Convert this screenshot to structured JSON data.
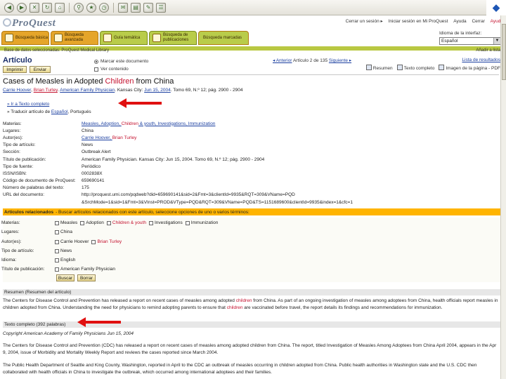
{
  "browser": {
    "logo_text": "◆"
  },
  "header": {
    "logo": "ProQuest",
    "top_links": [
      "Cerrar un sesión ▸",
      "Iniciar sesión en Mi ProQuest",
      "Ayuda",
      "Cerrar",
      "Ayuda"
    ],
    "language_label": "Idioma de la interfaz:",
    "language_value": "Español"
  },
  "tabs": [
    {
      "label": "Búsqueda básica"
    },
    {
      "label": "Búsqueda avanzada"
    },
    {
      "label": "Guía temática"
    },
    {
      "label": "Búsqueda de publicaciones"
    }
  ],
  "tab_plain": "Búsqueda marcadas",
  "breadcrumb": "Base de datos seleccionadas: ProQuest Medical Library",
  "breadcrumb_right": "Añadir a lista",
  "toolbar": {
    "title": "Artículo",
    "print_label": "Imprimir",
    "send_label": "Enviar",
    "opt1": "Marcar este documento",
    "opt2": "Ver contenido",
    "nav_prefix": "◂ Anterior",
    "nav_mid": "Artículo 2 de 135",
    "nav_next": "Siguiente ▸",
    "back_link": "Lista de resultados",
    "summary_label": "Resumen",
    "fulltext_label": "Texto completo",
    "pageimage_label": "Imagen de la página - PDF"
  },
  "article": {
    "title_pre": "Cases of Measles in Adopted ",
    "title_hl": "Children",
    "title_post": " from China",
    "author1": "Carrie Hoover",
    "author2": "Brian Turley",
    "journal": "American Family Physician",
    "byline_mid": ". Kansas City: ",
    "date": "Jun 15, 2004",
    "byline_end": ". Tomo 69, N.º 12; pág. 2900 - 2904",
    "bullet1": "» Ir a Texto completo",
    "bullet2_pre": "» Traducir artículo de ",
    "bullet2_lnk": "Español",
    "bullet2_post": ", Portugués"
  },
  "meta": [
    {
      "label": "Materias:",
      "value": "Measles, Adoption, ",
      "hl": "Children",
      "value2": " & youth, Investigations, Immunization"
    },
    {
      "label": "Lugares:",
      "value": "China",
      "hl": "",
      "value2": ""
    },
    {
      "label": "Autor(es):",
      "value": "Carrie Hoover, ",
      "hl": "Brian Turley",
      "value2": ""
    },
    {
      "label": "Tipo de artículo:",
      "value": "News",
      "hl": "",
      "value2": ""
    },
    {
      "label": "Sección:",
      "value": "Outbreak Alert",
      "hl": "",
      "value2": ""
    },
    {
      "label": "Título de publicación:",
      "value": "American Family Physician. Kansas City: Jun 15, 2004. Tomo 69, N.º 12; pág. 2900 - 2904",
      "hl": "",
      "value2": ""
    },
    {
      "label": "Tipo de fuente:",
      "value": "Periódico",
      "hl": "",
      "value2": ""
    },
    {
      "label": "ISSN/ISBN:",
      "value": "0002838X",
      "hl": "",
      "value2": ""
    },
    {
      "label": "Código de documento de ProQuest:",
      "value": "659690141",
      "hl": "",
      "value2": ""
    },
    {
      "label": "Número de palabras del texto:",
      "value": "175",
      "hl": "",
      "value2": ""
    },
    {
      "label": "URL del documento:",
      "value": "http://proquest.umi.com/pqdweb?did=659690141&sid=2&Fmt=3&clientId=9935&RQT=309&VName=PQD",
      "hl": "",
      "value2": ""
    },
    {
      "label": "",
      "value": "&SrchMode=1&sid=1&Fmt=3&VInst=PROD&VType=PQD&RQT=309&VName=PQD&TS=1151689600&clientId=9935&index=1&cfc=1",
      "hl": "",
      "value2": ""
    }
  ],
  "related": {
    "bar_title": "Artículos relacionados",
    "bar_text": "- Buscar artículos relacionados con este artículo, seleccione opciones de uno o varios términos:",
    "rows": [
      {
        "label": "Materias:",
        "items": [
          "Measles",
          "Adoption",
          "Children & youth",
          "Investigations",
          "Immunization"
        ]
      },
      {
        "label": "Lugares:",
        "items": [
          "China"
        ]
      },
      {
        "label": "Autor(es):",
        "items": [
          "Carrie Hoover",
          "Brian Turley"
        ]
      },
      {
        "label": "Tipo de artículo:",
        "items": [
          "News"
        ]
      },
      {
        "label": "Idioma:",
        "items": [
          "English"
        ]
      },
      {
        "label": "Título de publicación:",
        "items": [
          "American Family Physician"
        ]
      }
    ],
    "search_btn": "Buscar",
    "clear_btn": "Borrar"
  },
  "summary": {
    "bar": "Resumen (Resumen del artículo)",
    "p1_a": "The Centers for Disease Control and Prevention has released a report on recent cases of measles among adopted ",
    "p1_hl": "children",
    "p1_b": " from China. As part of an ongoing investigation of measles among adoptees from China, ",
    "p1_c": "health officials report measles in children adopted from China. Understanding the need for physicians to remind adopting parents to ensure that ",
    "p1_hl2": "children",
    "p1_d": " are vaccinated before travel, the report details its findings and recommendations for immunization."
  },
  "fulltext": {
    "bar": "Texto completo (392 palabras)",
    "copyright": "Copyright American Academy of Family Physicians Jun 15, 2004",
    "p1": "The Centers for Disease Control and Prevention (CDC) has released a report on recent cases of measles among adopted children from China. The report, titled Investigation of Measles Among Adoptees from China April 2004, appears in the Apr 9, 2004, issue of Morbidity and Mortality Weekly Report and reviews the cases reported since March 2004.",
    "p2": "The Public Health Department of Seattle and King County, Washington, reported in April to the CDC an outbreak of measles occurring in children adopted from China. Public health authorities in Washington state and the U.S. CDC then collaborated with health officials in China to investigate the outbreak, which occurred among international adoptees and their families."
  }
}
